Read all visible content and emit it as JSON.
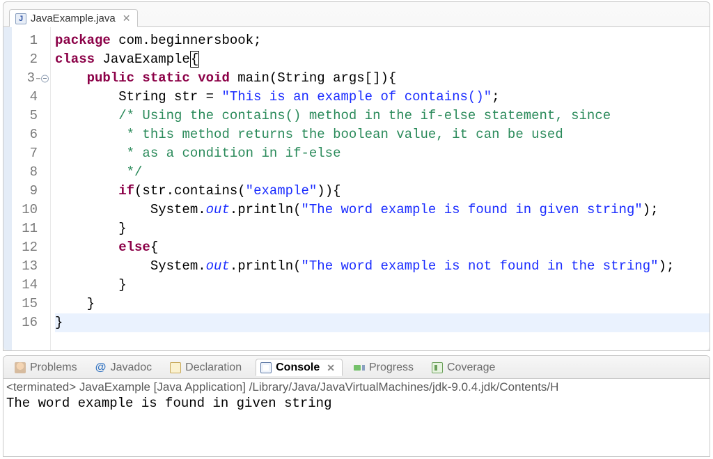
{
  "editor": {
    "tab": {
      "filename": "JavaExample.java"
    },
    "lines": {
      "count": 16,
      "l1": {
        "kw1": "package",
        "rest": " com.beginnersbook;"
      },
      "l2": {
        "kw1": "class",
        "name": " JavaExample",
        "brace": "{"
      },
      "l3": {
        "kw": "public static void",
        "sig": " main(String args[]){"
      },
      "l4": {
        "indent": "        ",
        "t1": "String str = ",
        "str": "\"This is an example of contains()\"",
        "semi": ";"
      },
      "l5": {
        "indent": "        ",
        "cmt": "/* Using the contains() method in the if-else statement, since"
      },
      "l6": {
        "indent": "         ",
        "cmt": "* this method returns the boolean value, it can be used"
      },
      "l7": {
        "indent": "         ",
        "cmt": "* as a condition in if-else"
      },
      "l8": {
        "indent": "         ",
        "cmt": "*/"
      },
      "l9": {
        "indent": "        ",
        "kw": "if",
        "p1": "(str.contains(",
        "str": "\"example\"",
        "p2": ")){"
      },
      "l10": {
        "indent": "            ",
        "t1": "System.",
        "out": "out",
        "t2": ".println(",
        "str": "\"The word example is found in given string\"",
        "t3": ");"
      },
      "l11": {
        "indent": "        ",
        "brace": "}"
      },
      "l12": {
        "indent": "        ",
        "kw": "else",
        "brace": "{"
      },
      "l13": {
        "indent": "            ",
        "t1": "System.",
        "out": "out",
        "t2": ".println(",
        "str": "\"The word example is not found in the string\"",
        "t3": ");"
      },
      "l14": {
        "indent": "        ",
        "brace": "}"
      },
      "l15": {
        "indent": "    ",
        "brace": "}"
      },
      "l16": {
        "brace": "}"
      }
    }
  },
  "bottom": {
    "tabs": {
      "problems": "Problems",
      "javadoc": "Javadoc",
      "declaration": "Declaration",
      "console": "Console",
      "progress": "Progress",
      "coverage": "Coverage"
    },
    "status": "<terminated> JavaExample [Java Application] /Library/Java/JavaVirtualMachines/jdk-9.0.4.jdk/Contents/H",
    "output": "The word example is found in given string"
  }
}
